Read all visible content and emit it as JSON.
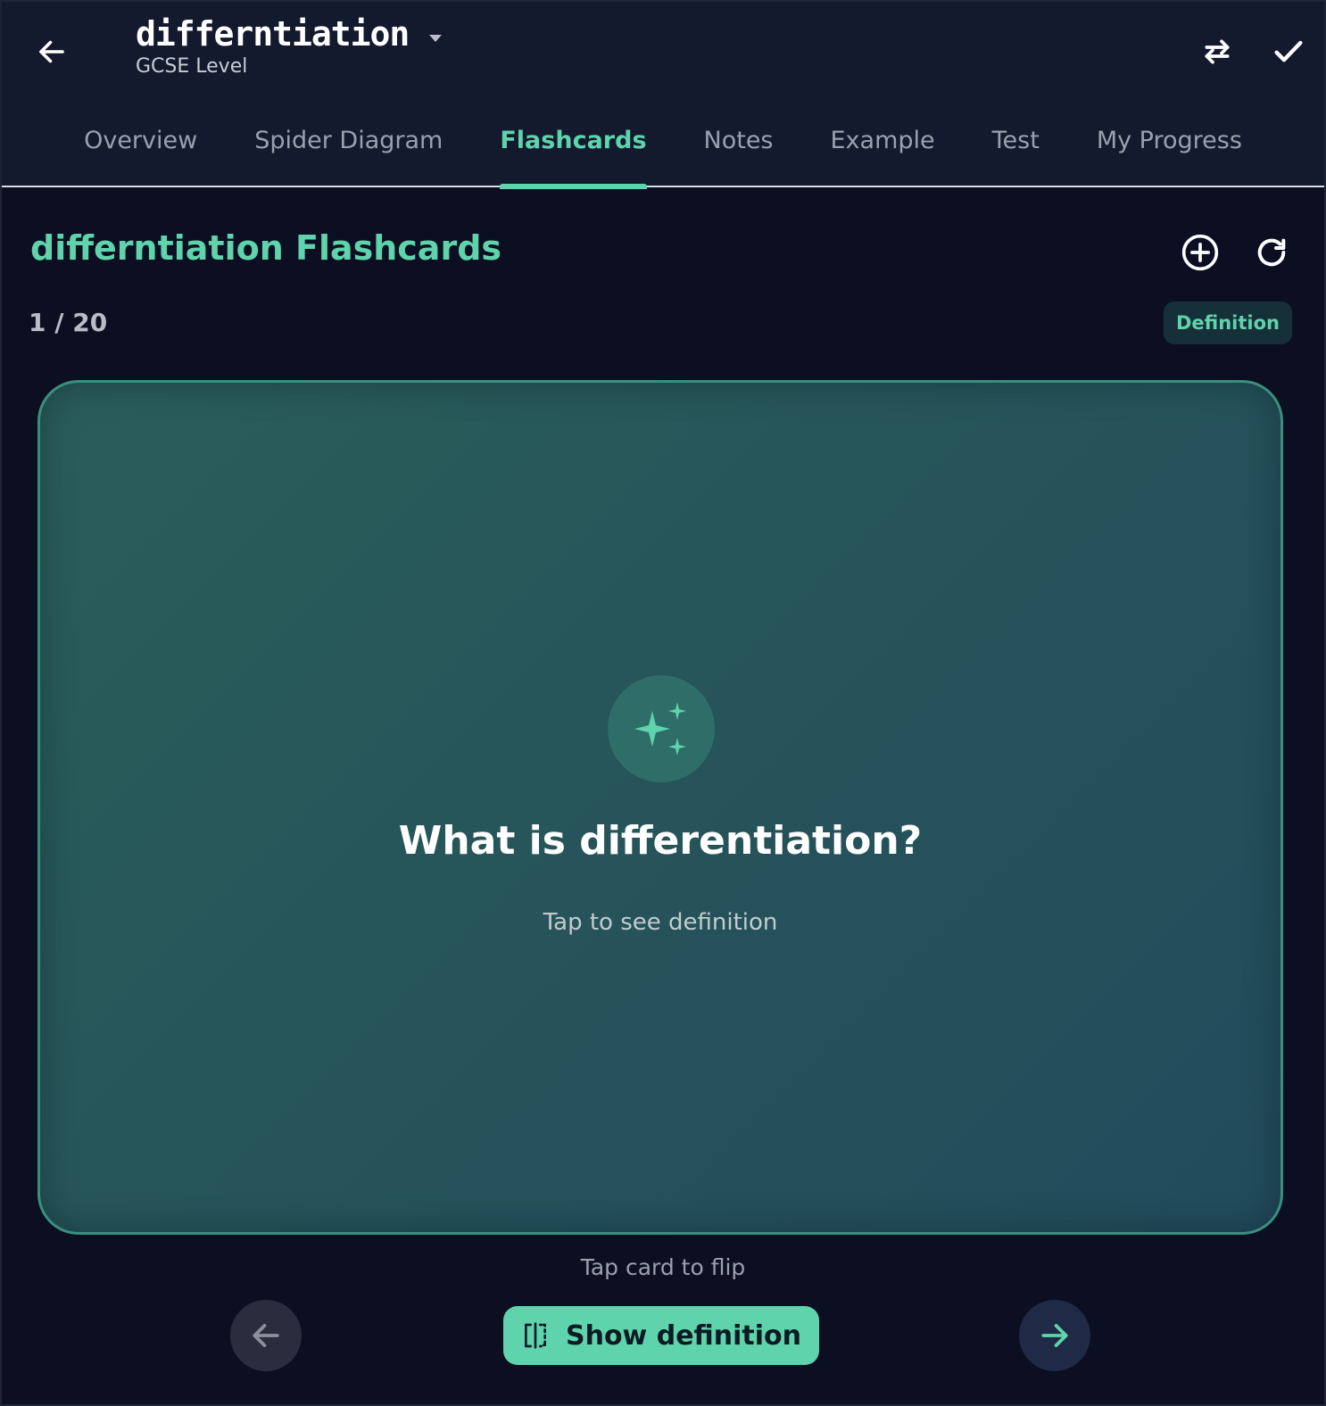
{
  "header": {
    "title": "differntiation",
    "subtitle": "GCSE Level",
    "icons": {
      "back": "arrow-left-icon",
      "dropdown": "caret-down-icon",
      "swap": "swap-arrows-icon",
      "confirm": "check-icon"
    }
  },
  "tabs": [
    {
      "label": "Overview",
      "active": false
    },
    {
      "label": "Spider Diagram",
      "active": false
    },
    {
      "label": "Flashcards",
      "active": true
    },
    {
      "label": "Notes",
      "active": false
    },
    {
      "label": "Example",
      "active": false
    },
    {
      "label": "Test",
      "active": false
    },
    {
      "label": "My Progress",
      "active": false
    }
  ],
  "section": {
    "title": "differntiation Flashcards",
    "counter": "1 / 20",
    "mode_badge": "Definition",
    "icons": {
      "add": "plus-circle-icon",
      "refresh": "refresh-icon"
    }
  },
  "card": {
    "icon": "sparkles-icon",
    "question": "What is differentiation?",
    "hint": "Tap to see definition"
  },
  "footer": {
    "flip_hint": "Tap card to flip",
    "show_button_label": "Show definition",
    "icons": {
      "prev": "arrow-left-icon",
      "next": "arrow-right-icon",
      "show": "flip-icon"
    }
  },
  "colors": {
    "accent": "#5fd3ac",
    "background": "#0b0f21",
    "header_bg": "#131a2e",
    "card_border": "#3a8f80"
  }
}
